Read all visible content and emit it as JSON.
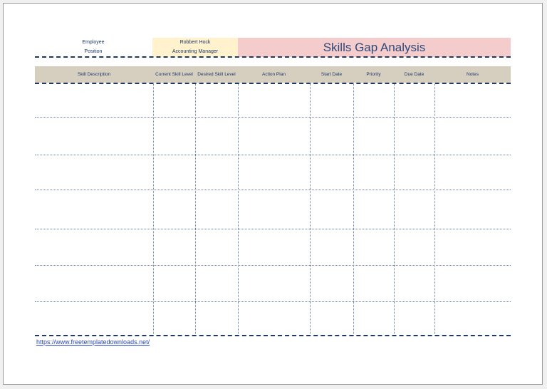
{
  "header": {
    "employee_label": "Employee",
    "position_label": "Position",
    "employee_value": "Robbert Hock",
    "position_value": "Accounting Manager",
    "title": "Skills Gap Analysis"
  },
  "table": {
    "columns": [
      "Skill Description",
      "Current Skill Level",
      "Desired Skill Level",
      "Action Plan",
      "Start Date",
      "Priority",
      "Due Date",
      "Notes"
    ],
    "rows": [
      [
        "",
        "",
        "",
        "",
        "",
        "",
        "",
        ""
      ],
      [
        "",
        "",
        "",
        "",
        "",
        "",
        "",
        ""
      ],
      [
        "",
        "",
        "",
        "",
        "",
        "",
        "",
        ""
      ],
      [
        "",
        "",
        "",
        "",
        "",
        "",
        "",
        ""
      ],
      [
        "",
        "",
        "",
        "",
        "",
        "",
        "",
        ""
      ],
      [
        "",
        "",
        "",
        "",
        "",
        "",
        "",
        ""
      ],
      [
        "",
        "",
        "",
        "",
        "",
        "",
        "",
        ""
      ]
    ]
  },
  "footer": {
    "link_text": "https://www.freetemplatedownloads.net/"
  },
  "colors": {
    "value_fill": "#fff2cc",
    "title_fill": "#f4cccc",
    "header_fill": "#d6cfc0",
    "ink": "#1f3864"
  }
}
